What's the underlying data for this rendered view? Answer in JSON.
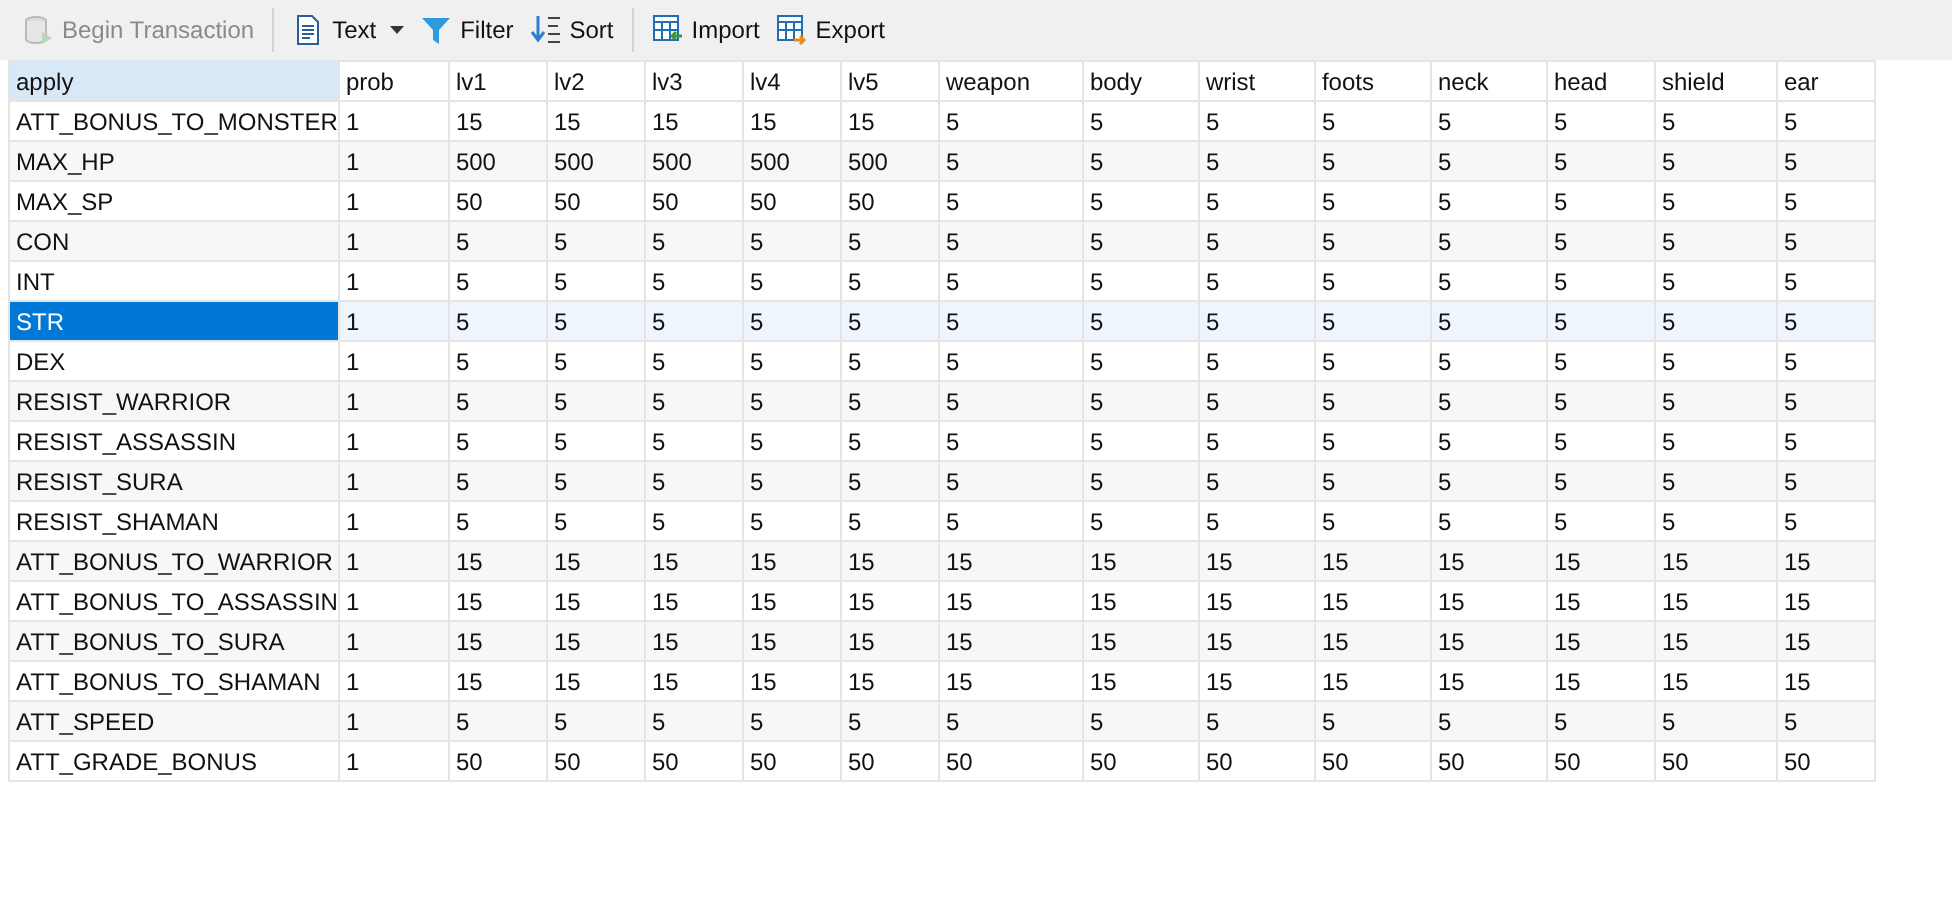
{
  "toolbar": {
    "groups": [
      [
        {
          "kind": "transaction",
          "label": "Begin Transaction",
          "disabled": true
        }
      ],
      [
        {
          "kind": "text",
          "label": "Text",
          "disabled": false,
          "dropdown": true
        },
        {
          "kind": "filter",
          "label": "Filter",
          "disabled": false,
          "dropdown": false
        },
        {
          "kind": "sort",
          "label": "Sort",
          "disabled": false,
          "dropdown": false
        }
      ],
      [
        {
          "kind": "import",
          "label": "Import",
          "disabled": false,
          "dropdown": false
        },
        {
          "kind": "export",
          "label": "Export",
          "disabled": false,
          "dropdown": false
        }
      ]
    ]
  },
  "table": {
    "columns": [
      {
        "label": "apply",
        "selected": true
      },
      {
        "label": "prob",
        "selected": false
      },
      {
        "label": "lv1",
        "selected": false
      },
      {
        "label": "lv2",
        "selected": false
      },
      {
        "label": "lv3",
        "selected": false
      },
      {
        "label": "lv4",
        "selected": false
      },
      {
        "label": "lv5",
        "selected": false
      },
      {
        "label": "weapon",
        "selected": false
      },
      {
        "label": "body",
        "selected": false
      },
      {
        "label": "wrist",
        "selected": false
      },
      {
        "label": "foots",
        "selected": false
      },
      {
        "label": "neck",
        "selected": false
      },
      {
        "label": "head",
        "selected": false
      },
      {
        "label": "shield",
        "selected": false
      },
      {
        "label": "ear",
        "selected": false
      }
    ],
    "rows": [
      {
        "selected": false,
        "cells": [
          "ATT_BONUS_TO_MONSTER",
          "1",
          "15",
          "15",
          "15",
          "15",
          "15",
          "5",
          "5",
          "5",
          "5",
          "5",
          "5",
          "5",
          "5"
        ]
      },
      {
        "selected": false,
        "cells": [
          "MAX_HP",
          "1",
          "500",
          "500",
          "500",
          "500",
          "500",
          "5",
          "5",
          "5",
          "5",
          "5",
          "5",
          "5",
          "5"
        ]
      },
      {
        "selected": false,
        "cells": [
          "MAX_SP",
          "1",
          "50",
          "50",
          "50",
          "50",
          "50",
          "5",
          "5",
          "5",
          "5",
          "5",
          "5",
          "5",
          "5"
        ]
      },
      {
        "selected": false,
        "cells": [
          "CON",
          "1",
          "5",
          "5",
          "5",
          "5",
          "5",
          "5",
          "5",
          "5",
          "5",
          "5",
          "5",
          "5",
          "5"
        ]
      },
      {
        "selected": false,
        "cells": [
          "INT",
          "1",
          "5",
          "5",
          "5",
          "5",
          "5",
          "5",
          "5",
          "5",
          "5",
          "5",
          "5",
          "5",
          "5"
        ]
      },
      {
        "selected": true,
        "cells": [
          "STR",
          "1",
          "5",
          "5",
          "5",
          "5",
          "5",
          "5",
          "5",
          "5",
          "5",
          "5",
          "5",
          "5",
          "5"
        ]
      },
      {
        "selected": false,
        "cells": [
          "DEX",
          "1",
          "5",
          "5",
          "5",
          "5",
          "5",
          "5",
          "5",
          "5",
          "5",
          "5",
          "5",
          "5",
          "5"
        ]
      },
      {
        "selected": false,
        "cells": [
          "RESIST_WARRIOR",
          "1",
          "5",
          "5",
          "5",
          "5",
          "5",
          "5",
          "5",
          "5",
          "5",
          "5",
          "5",
          "5",
          "5"
        ]
      },
      {
        "selected": false,
        "cells": [
          "RESIST_ASSASSIN",
          "1",
          "5",
          "5",
          "5",
          "5",
          "5",
          "5",
          "5",
          "5",
          "5",
          "5",
          "5",
          "5",
          "5"
        ]
      },
      {
        "selected": false,
        "cells": [
          "RESIST_SURA",
          "1",
          "5",
          "5",
          "5",
          "5",
          "5",
          "5",
          "5",
          "5",
          "5",
          "5",
          "5",
          "5",
          "5"
        ]
      },
      {
        "selected": false,
        "cells": [
          "RESIST_SHAMAN",
          "1",
          "5",
          "5",
          "5",
          "5",
          "5",
          "5",
          "5",
          "5",
          "5",
          "5",
          "5",
          "5",
          "5"
        ]
      },
      {
        "selected": false,
        "cells": [
          "ATT_BONUS_TO_WARRIOR",
          "1",
          "15",
          "15",
          "15",
          "15",
          "15",
          "15",
          "15",
          "15",
          "15",
          "15",
          "15",
          "15",
          "15"
        ]
      },
      {
        "selected": false,
        "cells": [
          "ATT_BONUS_TO_ASSASSIN",
          "1",
          "15",
          "15",
          "15",
          "15",
          "15",
          "15",
          "15",
          "15",
          "15",
          "15",
          "15",
          "15",
          "15"
        ]
      },
      {
        "selected": false,
        "cells": [
          "ATT_BONUS_TO_SURA",
          "1",
          "15",
          "15",
          "15",
          "15",
          "15",
          "15",
          "15",
          "15",
          "15",
          "15",
          "15",
          "15",
          "15"
        ]
      },
      {
        "selected": false,
        "cells": [
          "ATT_BONUS_TO_SHAMAN",
          "1",
          "15",
          "15",
          "15",
          "15",
          "15",
          "15",
          "15",
          "15",
          "15",
          "15",
          "15",
          "15",
          "15"
        ]
      },
      {
        "selected": false,
        "cells": [
          "ATT_SPEED",
          "1",
          "5",
          "5",
          "5",
          "5",
          "5",
          "5",
          "5",
          "5",
          "5",
          "5",
          "5",
          "5",
          "5"
        ]
      },
      {
        "selected": false,
        "cells": [
          "ATT_GRADE_BONUS",
          "1",
          "50",
          "50",
          "50",
          "50",
          "50",
          "50",
          "50",
          "50",
          "50",
          "50",
          "50",
          "50",
          "50"
        ]
      }
    ]
  }
}
